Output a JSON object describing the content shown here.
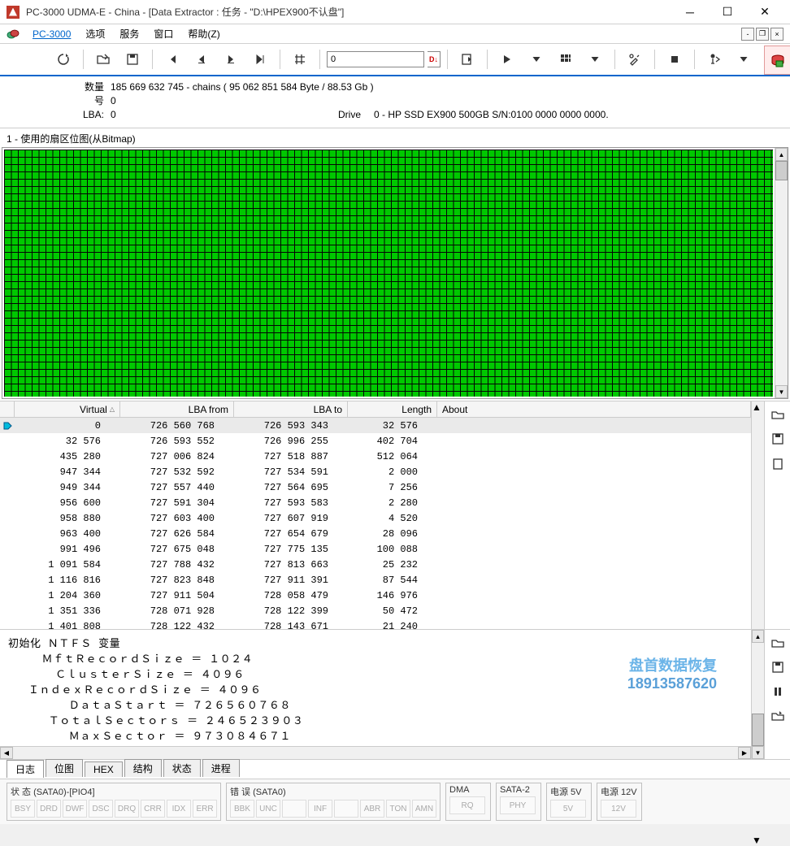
{
  "window": {
    "title": "PC-3000 UDMA-E - China - [Data Extractor : 任务 - \"D:\\HPEX900不认盘\"]"
  },
  "menu": {
    "app": "PC-3000",
    "items": [
      "选项",
      "服务",
      "窗口",
      "帮助(Z)"
    ]
  },
  "info": {
    "qty_label": "数量",
    "qty_value": "185 669 632   745 - chains  ( 95 062 851 584 Byte /   88.53 Gb )",
    "num_label": "号",
    "num_value": "0",
    "lba_label": "LBA:",
    "lba_value": "0",
    "drive_label": "Drive",
    "drive_value": "0 - HP SSD EX900 500GB  S/N:0100 0000 0000 0000."
  },
  "toolbar": {
    "input_value": "0"
  },
  "bitmap": {
    "title": "1 - 使用的扇区位图(从Bitmap)"
  },
  "table": {
    "headers": {
      "virtual": "Virtual",
      "lba_from": "LBA from",
      "lba_to": "LBA to",
      "length": "Length",
      "about": "About"
    },
    "rows": [
      {
        "virtual": "0",
        "lba_from": "726 560 768",
        "lba_to": "726 593 343",
        "length": "32 576",
        "current": true
      },
      {
        "virtual": "32 576",
        "lba_from": "726 593 552",
        "lba_to": "726 996 255",
        "length": "402 704"
      },
      {
        "virtual": "435 280",
        "lba_from": "727 006 824",
        "lba_to": "727 518 887",
        "length": "512 064"
      },
      {
        "virtual": "947 344",
        "lba_from": "727 532 592",
        "lba_to": "727 534 591",
        "length": "2 000"
      },
      {
        "virtual": "949 344",
        "lba_from": "727 557 440",
        "lba_to": "727 564 695",
        "length": "7 256"
      },
      {
        "virtual": "956 600",
        "lba_from": "727 591 304",
        "lba_to": "727 593 583",
        "length": "2 280"
      },
      {
        "virtual": "958 880",
        "lba_from": "727 603 400",
        "lba_to": "727 607 919",
        "length": "4 520"
      },
      {
        "virtual": "963 400",
        "lba_from": "727 626 584",
        "lba_to": "727 654 679",
        "length": "28 096"
      },
      {
        "virtual": "991 496",
        "lba_from": "727 675 048",
        "lba_to": "727 775 135",
        "length": "100 088"
      },
      {
        "virtual": "1 091 584",
        "lba_from": "727 788 432",
        "lba_to": "727 813 663",
        "length": "25 232"
      },
      {
        "virtual": "1 116 816",
        "lba_from": "727 823 848",
        "lba_to": "727 911 391",
        "length": "87 544"
      },
      {
        "virtual": "1 204 360",
        "lba_from": "727 911 504",
        "lba_to": "728 058 479",
        "length": "146 976"
      },
      {
        "virtual": "1 351 336",
        "lba_from": "728 071 928",
        "lba_to": "728 122 399",
        "length": "50 472"
      },
      {
        "virtual": "1 401 808",
        "lba_from": "728 122 432",
        "lba_to": "728 143 671",
        "length": "21 240"
      }
    ]
  },
  "log": {
    "text": "初始化 ＮＴＦＳ 变量\n     ＭｆｔＲｅｃｏｒｄＳｉｚｅ ＝ １０２４\n       ＣｌｕｓｔｅｒＳｉｚｅ ＝ ４０９６\n   ＩｎｄｅｘＲｅｃｏｒｄＳｉｚｅ ＝ ４０９６\n         ＤａｔａＳｔａｒｔ ＝ ７２６５６０７６８\n      ＴｏｔａｌＳｅｃｔｏｒｓ ＝ ２４６５２３９０３\n         ＭａｘＳｅｃｔｏｒ ＝ ９７３０８４６７１\n      Ｌｏａｄ ＭＦＴ ｍａｐ   － Ｍａｐ ｆｉｌｌｅｄ\n      Ｌｏａｄ ＭＦＴ ｍａｐ   － Ｍａｐ ｆｉｌｌｅｄ"
  },
  "watermark": {
    "line1": "盘首数据恢复",
    "line2": "18913587620"
  },
  "tabs": {
    "items": [
      "日志",
      "位图",
      "HEX",
      "结构",
      "状态",
      "进程"
    ],
    "active": 0
  },
  "status": {
    "sata0": {
      "title": "状 态 (SATA0)-[PIO4]",
      "cells": [
        "BSY",
        "DRD",
        "DWF",
        "DSC",
        "DRQ",
        "CRR",
        "IDX",
        "ERR"
      ]
    },
    "errors": {
      "title": "错 误 (SATA0)",
      "cells": [
        "BBK",
        "UNC",
        "",
        "INF",
        "",
        "ABR",
        "TON",
        "AMN"
      ]
    },
    "dma": {
      "title": "DMA",
      "cells": [
        "RQ"
      ]
    },
    "sata2": {
      "title": "SATA-2",
      "cells": [
        "PHY"
      ]
    },
    "power5v": {
      "title": "电源 5V",
      "cells": [
        "5V"
      ]
    },
    "power12v": {
      "title": "电源 12V",
      "cells": [
        "12V"
      ]
    }
  }
}
